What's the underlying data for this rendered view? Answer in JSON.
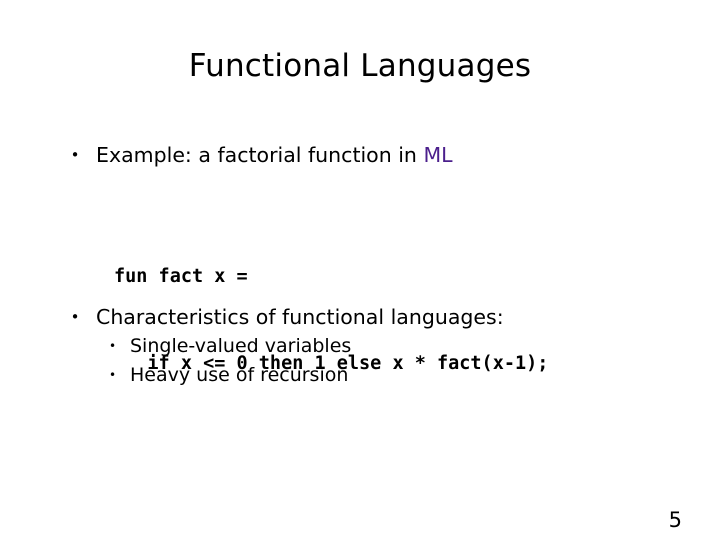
{
  "slide": {
    "title": "Functional Languages",
    "page_number": "5",
    "background_color": "#ffffff",
    "text_color": "#000000",
    "accent_color": "#4b1f8c"
  },
  "bullets": [
    {
      "marker": "•",
      "text_before": "Example: a factorial function in ",
      "highlight": "ML",
      "highlight_color": "#4b1f8c"
    },
    {
      "marker": "•",
      "text": "Characteristics of functional languages:"
    }
  ],
  "code": {
    "language": "ML",
    "lines": [
      "fun fact x =",
      "   if x <= 0 then 1 else x * fact(x-1);"
    ]
  },
  "sub_bullets": [
    {
      "marker": "•",
      "text": "Single-valued variables"
    },
    {
      "marker": "•",
      "text": "Heavy use of recursion"
    }
  ]
}
